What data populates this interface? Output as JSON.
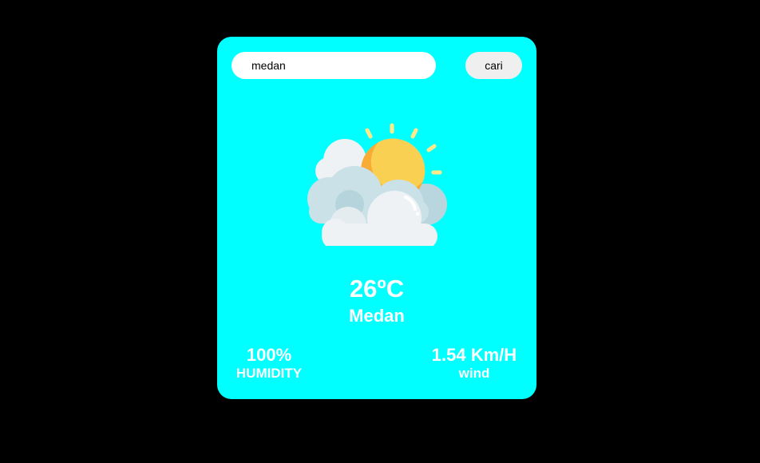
{
  "search": {
    "value": "medan",
    "button_label": "cari"
  },
  "weather": {
    "icon": "partly-cloudy-sun-icon",
    "temperature": "26ºC",
    "city": "Medan"
  },
  "stats": {
    "humidity_value": "100%",
    "humidity_label": "HUMIDITY",
    "wind_value": "1.54 Km/H",
    "wind_label": "wind"
  },
  "colors": {
    "page_background": "#000000",
    "card_background": "#00ffff",
    "text": "#ffffff"
  }
}
